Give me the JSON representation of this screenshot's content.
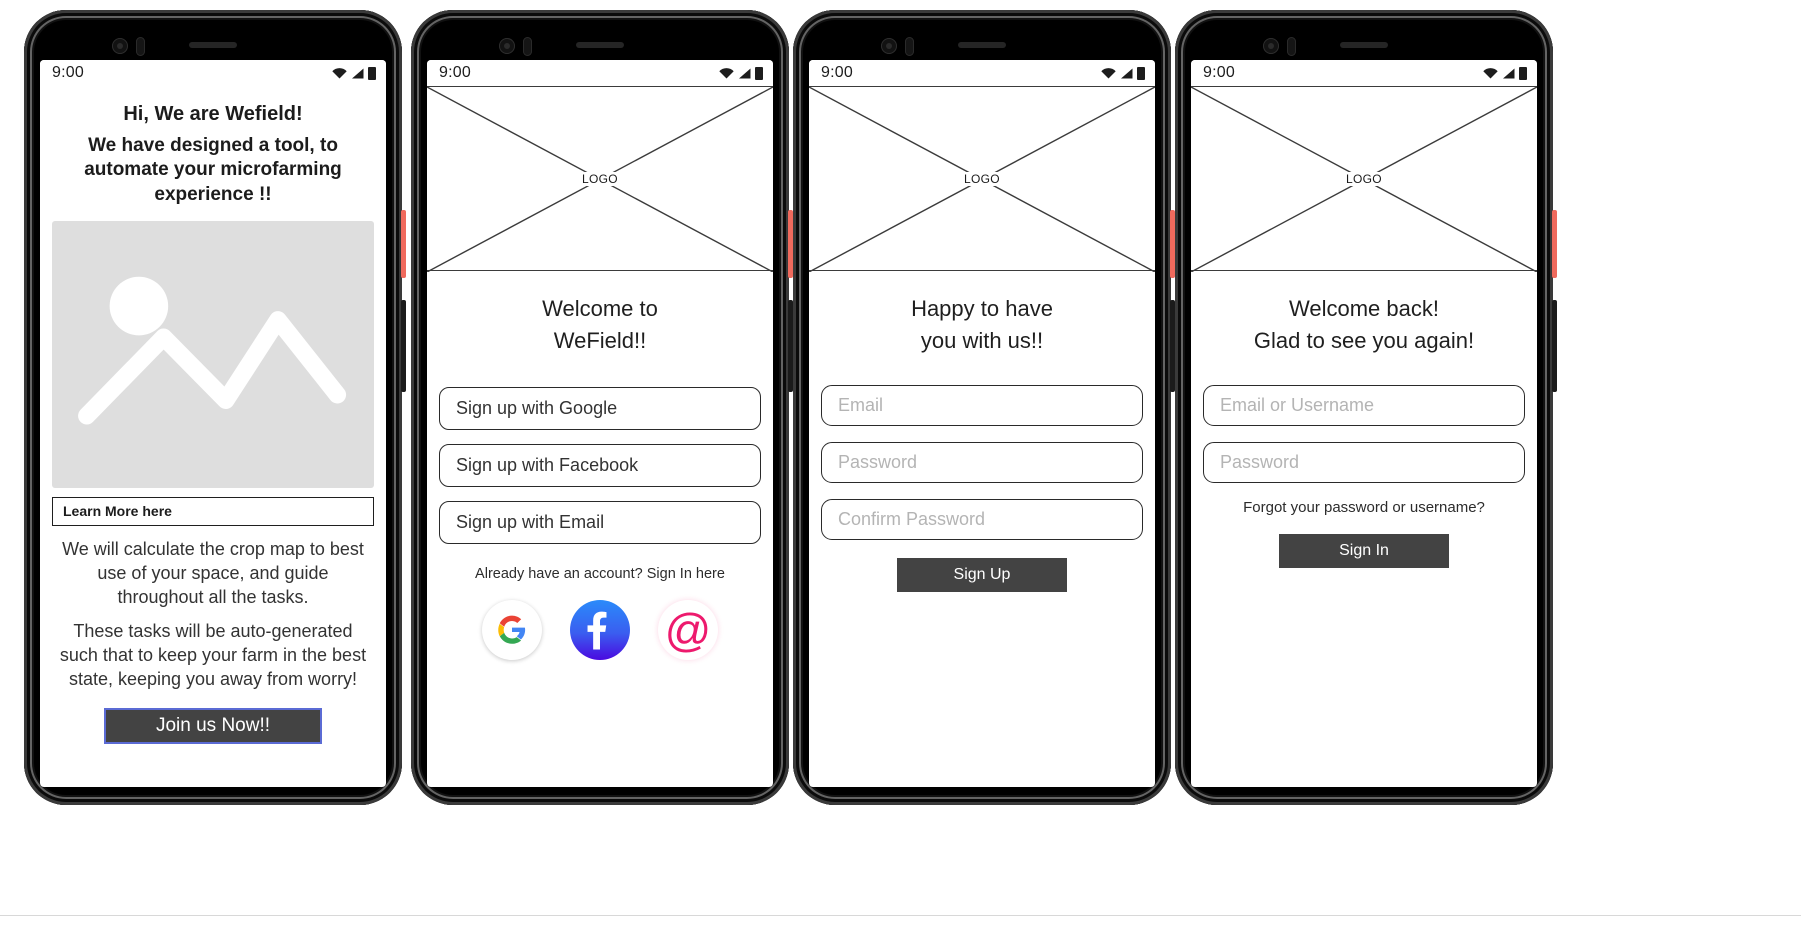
{
  "app": {
    "name": "Wefield",
    "mockup_title": "Wefield onboarding and authentication wireframes"
  },
  "status_bar": {
    "time": "9:00",
    "icons": [
      "wifi-icon",
      "signal-icon",
      "battery-icon"
    ]
  },
  "screens": [
    {
      "id": "onboarding",
      "title_line1": "Hi, We are Wefield!",
      "subtitle": "We have designed a tool, to automate your microfarming experience !!",
      "image_placeholder": "image-placeholder",
      "learn_more_label": "Learn More here",
      "paragraph1": "We will calculate the crop map to best use of your space, and guide throughout all the tasks.",
      "paragraph2": "These tasks will be auto-generated such that to keep your farm in the best state, keeping you away from worry!",
      "cta_label": "Join us Now!!"
    },
    {
      "id": "signup-options",
      "logo_label": "LOGO",
      "heading": "Welcome to\nWeField!!",
      "heading_line1": "Welcome to",
      "heading_line2": "WeField!!",
      "buttons": [
        {
          "label": "Sign up with Google"
        },
        {
          "label": "Sign up with Facebook"
        },
        {
          "label": "Sign up with Email"
        }
      ],
      "note": "Already have an account? Sign In here",
      "social_icons": [
        {
          "name": "google-icon",
          "glyph": "G"
        },
        {
          "name": "facebook-icon",
          "glyph": "f"
        },
        {
          "name": "email-at-icon",
          "glyph": "@"
        }
      ]
    },
    {
      "id": "signup-form",
      "logo_label": "LOGO",
      "heading_line1": "Happy to have",
      "heading_line2": "you with us!!",
      "fields": [
        {
          "name": "email-field",
          "placeholder": "Email"
        },
        {
          "name": "password-field",
          "placeholder": "Password"
        },
        {
          "name": "confirm-password-field",
          "placeholder": "Confirm Password"
        }
      ],
      "submit_label": "Sign Up"
    },
    {
      "id": "signin-form",
      "logo_label": "LOGO",
      "heading_line1": "Welcome back!",
      "heading_line2": "Glad to see you again!",
      "fields": [
        {
          "name": "email-or-username-field",
          "placeholder": "Email or Username"
        },
        {
          "name": "password-field",
          "placeholder": "Password"
        }
      ],
      "forgot_label": "Forgot your password or username?",
      "submit_label": "Sign In"
    }
  ],
  "colors": {
    "button_fill": "#434343",
    "button_border_accent": "#5b6bd4",
    "placeholder_text": "#b4b4b4",
    "image_placeholder_bg": "#dedede",
    "facebook_blue": "#3a5ef0",
    "at_pink": "#ed1a6d",
    "power_button": "#f06a5d"
  }
}
